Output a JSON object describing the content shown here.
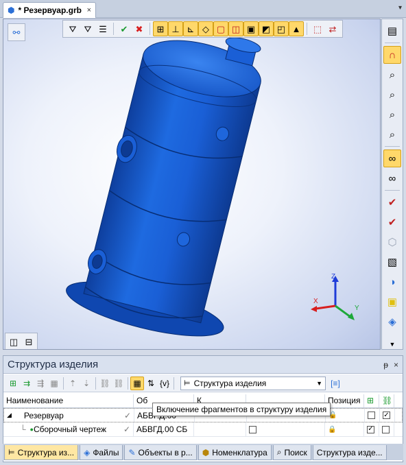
{
  "document_tab": {
    "title": "* Резервуар.grb",
    "close": "×"
  },
  "tabstrip_menu": "▾",
  "viewport": {
    "axes": {
      "x": "X",
      "y": "Y",
      "z": "Z"
    }
  },
  "panel": {
    "title": "Структура изделия",
    "pin": "ᵽ",
    "close": "×",
    "view_dropdown": {
      "value": "Структура изделия"
    },
    "columns": [
      "Наименование",
      "Об",
      "К",
      "",
      "Позиция"
    ],
    "rows": [
      {
        "expander": "◢",
        "name": "Резервуар",
        "object": "АБВГ.Д.00",
        "position": "",
        "lock": "🔒",
        "c1": false,
        "c2": true
      },
      {
        "expander": "",
        "name": "Сборочный чертеж",
        "object": "АБВГД.00 СБ",
        "position": "",
        "lock": "🔒",
        "c1": true,
        "c2": false
      }
    ],
    "tooltip": "Включение фрагментов в структуру изделия"
  },
  "bottom_tabs": [
    {
      "label": "Структура из...",
      "active": true
    },
    {
      "label": "Файлы",
      "active": false
    },
    {
      "label": "Объекты в р...",
      "active": false
    },
    {
      "label": "Номенклатура",
      "active": false
    },
    {
      "label": "Поиск",
      "active": false
    },
    {
      "label": "Структура изде...",
      "active": false
    }
  ],
  "colors": {
    "model_blue": "#1a5fd6",
    "accent_yellow": "#ffd86a",
    "panel_header": "#d9e1ef"
  }
}
